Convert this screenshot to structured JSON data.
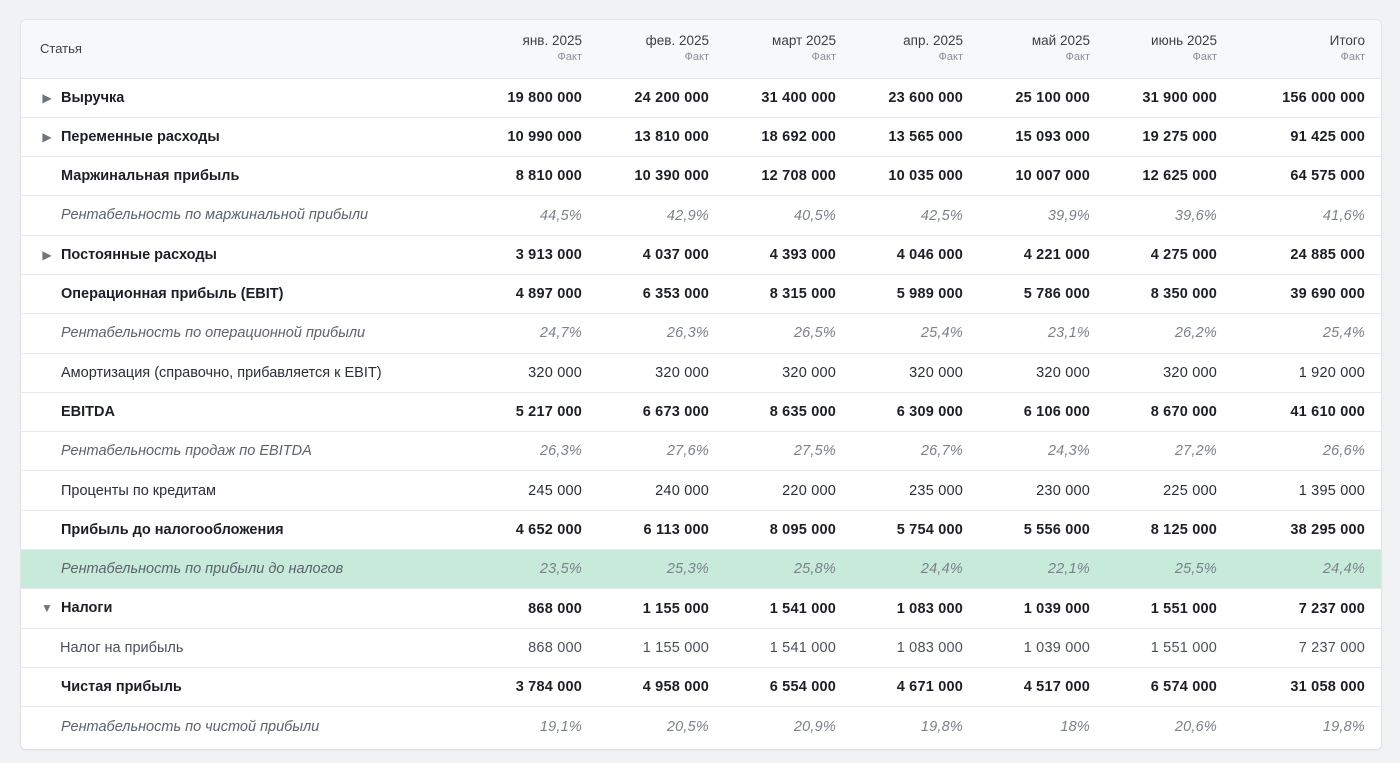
{
  "header": {
    "name": "Статья",
    "columns": [
      {
        "label": "янв. 2025",
        "sub": "Факт"
      },
      {
        "label": "фев. 2025",
        "sub": "Факт"
      },
      {
        "label": "март 2025",
        "sub": "Факт"
      },
      {
        "label": "апр. 2025",
        "sub": "Факт"
      },
      {
        "label": "май 2025",
        "sub": "Факт"
      },
      {
        "label": "июнь 2025",
        "sub": "Факт"
      },
      {
        "label": "Итого",
        "sub": "Факт"
      }
    ]
  },
  "rows": [
    {
      "name": "Выручка",
      "kind": "bold",
      "toggle": "▶",
      "values": [
        "19 800 000",
        "24 200 000",
        "31 400 000",
        "23 600 000",
        "25 100 000",
        "31 900 000",
        "156 000 000"
      ]
    },
    {
      "name": "Переменные расходы",
      "kind": "bold",
      "toggle": "▶",
      "values": [
        "10 990 000",
        "13 810 000",
        "18 692 000",
        "13 565 000",
        "15 093 000",
        "19 275 000",
        "91 425 000"
      ]
    },
    {
      "name": "Маржинальная прибыль",
      "kind": "bold",
      "values": [
        "8 810 000",
        "10 390 000",
        "12 708 000",
        "10 035 000",
        "10 007 000",
        "12 625 000",
        "64 575 000"
      ]
    },
    {
      "name": "Рентабельность по маржинальной прибыли",
      "kind": "ratio",
      "values": [
        "44,5%",
        "42,9%",
        "40,5%",
        "42,5%",
        "39,9%",
        "39,6%",
        "41,6%"
      ]
    },
    {
      "name": "Постоянные расходы",
      "kind": "bold",
      "toggle": "▶",
      "values": [
        "3 913 000",
        "4 037 000",
        "4 393 000",
        "4 046 000",
        "4 221 000",
        "4 275 000",
        "24 885 000"
      ]
    },
    {
      "name": "Операционная прибыль (EBIT)",
      "kind": "bold",
      "values": [
        "4 897 000",
        "6 353 000",
        "8 315 000",
        "5 989 000",
        "5 786 000",
        "8 350 000",
        "39 690 000"
      ]
    },
    {
      "name": "Рентабельность по операционной прибыли",
      "kind": "ratio",
      "values": [
        "24,7%",
        "26,3%",
        "26,5%",
        "25,4%",
        "23,1%",
        "26,2%",
        "25,4%"
      ]
    },
    {
      "name": "Амортизация (справочно, прибавляется к EBIT)",
      "kind": "normal",
      "values": [
        "320 000",
        "320 000",
        "320 000",
        "320 000",
        "320 000",
        "320 000",
        "1 920 000"
      ]
    },
    {
      "name": "EBITDA",
      "kind": "bold",
      "values": [
        "5 217 000",
        "6 673 000",
        "8 635 000",
        "6 309 000",
        "6 106 000",
        "8 670 000",
        "41 610 000"
      ]
    },
    {
      "name": "Рентабельность продаж по EBITDA",
      "kind": "ratio",
      "values": [
        "26,3%",
        "27,6%",
        "27,5%",
        "26,7%",
        "24,3%",
        "27,2%",
        "26,6%"
      ]
    },
    {
      "name": "Проценты по кредитам",
      "kind": "normal",
      "values": [
        "245 000",
        "240 000",
        "220 000",
        "235 000",
        "230 000",
        "225 000",
        "1 395 000"
      ]
    },
    {
      "name": "Прибыль до налогообложения",
      "kind": "bold",
      "values": [
        "4 652 000",
        "6 113 000",
        "8 095 000",
        "5 754 000",
        "5 556 000",
        "8 125 000",
        "38 295 000"
      ]
    },
    {
      "name": "Рентабельность по прибыли до налогов",
      "kind": "ratio",
      "highlight": true,
      "values": [
        "23,5%",
        "25,3%",
        "25,8%",
        "24,4%",
        "22,1%",
        "25,5%",
        "24,4%"
      ]
    },
    {
      "name": "Налоги",
      "kind": "bold",
      "toggle": "▼",
      "values": [
        "868 000",
        "1 155 000",
        "1 541 000",
        "1 083 000",
        "1 039 000",
        "1 551 000",
        "7 237 000"
      ]
    },
    {
      "name": "Налог на прибыль",
      "kind": "child",
      "values": [
        "868 000",
        "1 155 000",
        "1 541 000",
        "1 083 000",
        "1 039 000",
        "1 551 000",
        "7 237 000"
      ]
    },
    {
      "name": "Чистая прибыль",
      "kind": "bold",
      "values": [
        "3 784 000",
        "4 958 000",
        "6 554 000",
        "4 671 000",
        "4 517 000",
        "6 574 000",
        "31 058 000"
      ]
    },
    {
      "name": "Рентабельность по чистой прибыли",
      "kind": "ratio",
      "values": [
        "19,1%",
        "20,5%",
        "20,9%",
        "19,8%",
        "18%",
        "20,6%",
        "19,8%"
      ]
    }
  ],
  "colors": {
    "highlight_row": "#c7eadb",
    "card_bg": "#ffffff",
    "page_bg": "#f1f2f4"
  },
  "icons": {
    "collapsed": "triangle-right-icon",
    "expanded": "triangle-down-icon"
  }
}
